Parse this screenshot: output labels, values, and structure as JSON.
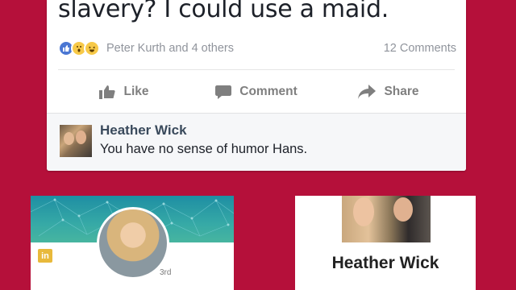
{
  "post": {
    "text": "slavery?  I could use a maid.",
    "reactions": {
      "icons": [
        "like-icon",
        "wow-icon",
        "haha-icon"
      ],
      "names": "Peter Kurth and 4 others",
      "comment_count": "12 Comments"
    },
    "actions": {
      "like": "Like",
      "comment": "Comment",
      "share": "Share"
    }
  },
  "comment": {
    "author": "Heather Wick",
    "text": "You have no sense of humor Hans."
  },
  "linkedin": {
    "badge": "in",
    "degree": "3rd"
  },
  "profile": {
    "name": "Heather Wick"
  },
  "colors": {
    "background": "#b5103a",
    "fb_blue": "#4b77d3",
    "action_gray": "#7f7f7f"
  }
}
